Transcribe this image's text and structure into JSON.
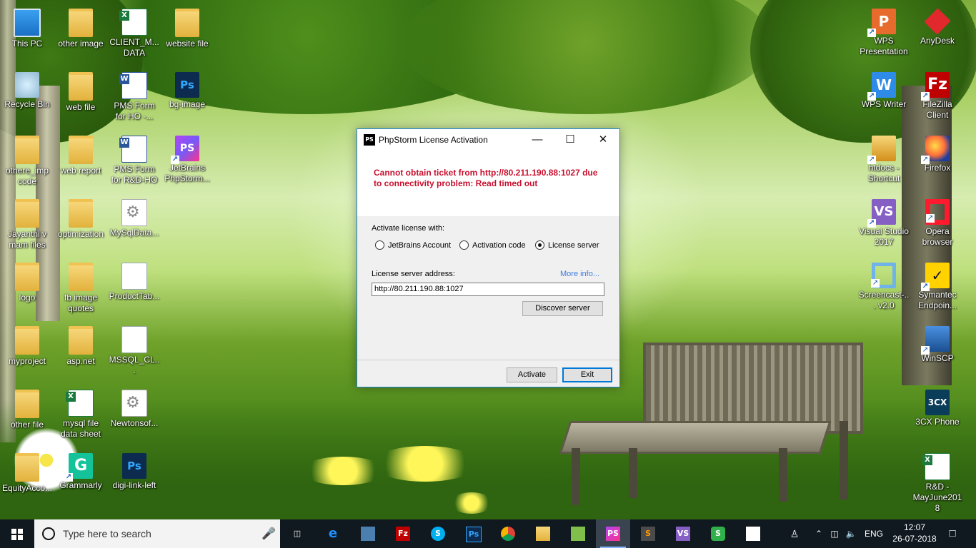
{
  "desktop": {
    "icons": [
      {
        "label": "This PC"
      },
      {
        "label": "other image"
      },
      {
        "label": "CLIENT_M... DATA"
      },
      {
        "label": "website file"
      },
      {
        "label": "Recycle Bin"
      },
      {
        "label": "web file"
      },
      {
        "label": "PMS Form for HO -..."
      },
      {
        "label": "bg-image"
      },
      {
        "label": "othere_imp code"
      },
      {
        "label": "web report"
      },
      {
        "label": "PMS Form for R&D-HO"
      },
      {
        "label": "JetBrains PhpStorm..."
      },
      {
        "label": "Jayanthi v mam files"
      },
      {
        "label": "optimization"
      },
      {
        "label": "MySqlData..."
      },
      {
        "label": "logo"
      },
      {
        "label": "fb image quotes"
      },
      {
        "label": "ProductTab..."
      },
      {
        "label": "myproject"
      },
      {
        "label": "asp.net"
      },
      {
        "label": "MSSQL_CL..."
      },
      {
        "label": "other file"
      },
      {
        "label": "mysql file data sheet"
      },
      {
        "label": "Newtonsof..."
      },
      {
        "label": "EquityAcco..."
      },
      {
        "label": "Grammarly"
      },
      {
        "label": "digi-link-left"
      },
      {
        "label": "WPS Presentation"
      },
      {
        "label": "AnyDesk"
      },
      {
        "label": "WPS Writer"
      },
      {
        "label": "FileZilla Client"
      },
      {
        "label": "htdocs - Shortcut"
      },
      {
        "label": "Firefox"
      },
      {
        "label": "Visual Studio 2017"
      },
      {
        "label": "Opera browser"
      },
      {
        "label": "Screencast-... v2.0"
      },
      {
        "label": "Symantec Endpoin..."
      },
      {
        "label": "WinSCP"
      },
      {
        "label": "3CX Phone"
      },
      {
        "label": "R&D - MayJune2018"
      }
    ]
  },
  "dialog": {
    "app_icon": "PS",
    "title": "PhpStorm License Activation",
    "error": "Cannot obtain ticket from http://80.211.190.88:1027 due to connectivity problem: Read timed out",
    "activate_with_label": "Activate license with:",
    "options": [
      {
        "label": "JetBrains Account",
        "checked": false
      },
      {
        "label": "Activation code",
        "checked": false
      },
      {
        "label": "License server",
        "checked": true
      }
    ],
    "server_address_label": "License server address:",
    "more_info": "More info...",
    "server_address_value": "http://80.211.190.88:1027",
    "discover_button": "Discover server",
    "activate_button": "Activate",
    "exit_button": "Exit"
  },
  "taskbar": {
    "search_placeholder": "Type here to search",
    "language": "ENG",
    "time": "12:07",
    "date": "26-07-2018"
  }
}
